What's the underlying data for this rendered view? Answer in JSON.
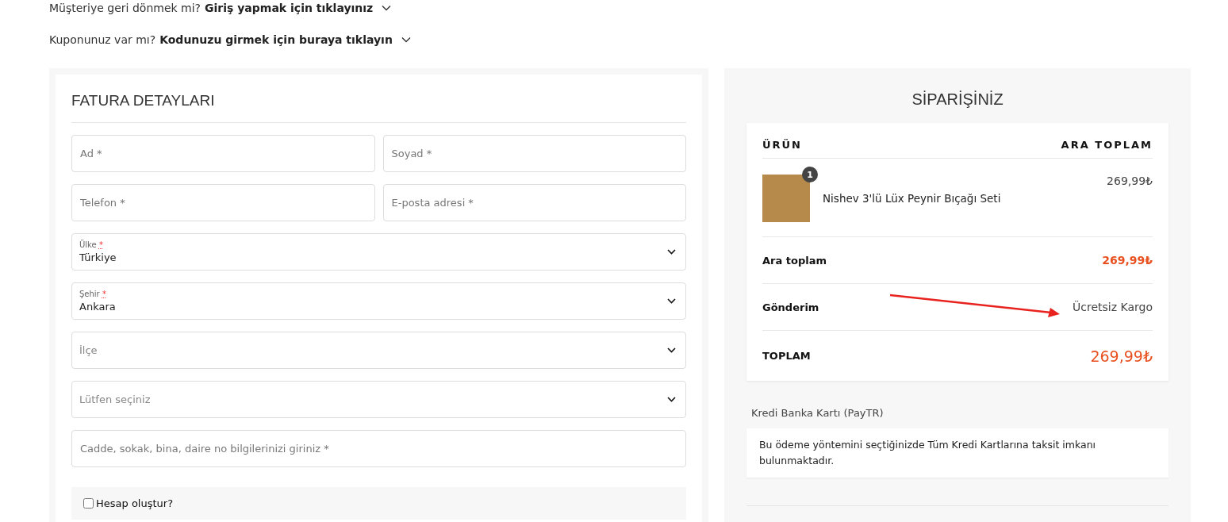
{
  "notices": [
    {
      "text": "Müşteriye geri dönmek mi?",
      "link": "Giriş yapmak için tıklayınız"
    },
    {
      "text": "Kuponunuz var mı?",
      "link": "Kodunuzu girmek için buraya tıklayın"
    }
  ],
  "billing": {
    "title": "FATURA DETAYLARI",
    "fields": [
      {
        "kind": "text",
        "placeholder": "Ad *",
        "half": true
      },
      {
        "kind": "text",
        "placeholder": "Soyad *",
        "half": true
      },
      {
        "kind": "text",
        "placeholder": "Telefon *",
        "half": true
      },
      {
        "kind": "text",
        "placeholder": "E-posta adresi *",
        "half": true
      },
      {
        "kind": "select",
        "label": "Ülke",
        "required": "*",
        "value": "Türkiye"
      },
      {
        "kind": "select",
        "label": "Şehir",
        "required": "*",
        "value": "Ankara"
      },
      {
        "kind": "select",
        "placeholder": "İlçe"
      },
      {
        "kind": "select",
        "placeholder": "Lütfen seçiniz"
      },
      {
        "kind": "text",
        "placeholder": "Cadde, sokak, bina, daire no bilgilerinizi giriniz *"
      }
    ],
    "create_account": {
      "label": "Hesap oluştur?",
      "checked": false
    }
  },
  "order": {
    "title": "SİPARİŞİNİZ",
    "columns": [
      "ÜRÜN",
      "ARA TOPLAM"
    ],
    "items": [
      {
        "name": "Nishev 3'lü Lüx Peynir Bıçağı Seti",
        "quantity": "1",
        "price": "269,99₺"
      }
    ],
    "totals": [
      {
        "kind": "subtotal",
        "label": "Ara toplam",
        "value": "269,99₺"
      },
      {
        "kind": "shipping",
        "label": "Gönderim",
        "value": "Ücretsiz Kargo"
      },
      {
        "kind": "total",
        "label": "TOPLAM",
        "value": "269,99₺"
      }
    ],
    "payment": {
      "title": "Kredi Banka Kartı (PayTR)",
      "description": "Bu ödeme yöntemini seçtiğinizde Tüm Kredi Kartlarına taksit imkanı bulunmaktadır."
    }
  }
}
